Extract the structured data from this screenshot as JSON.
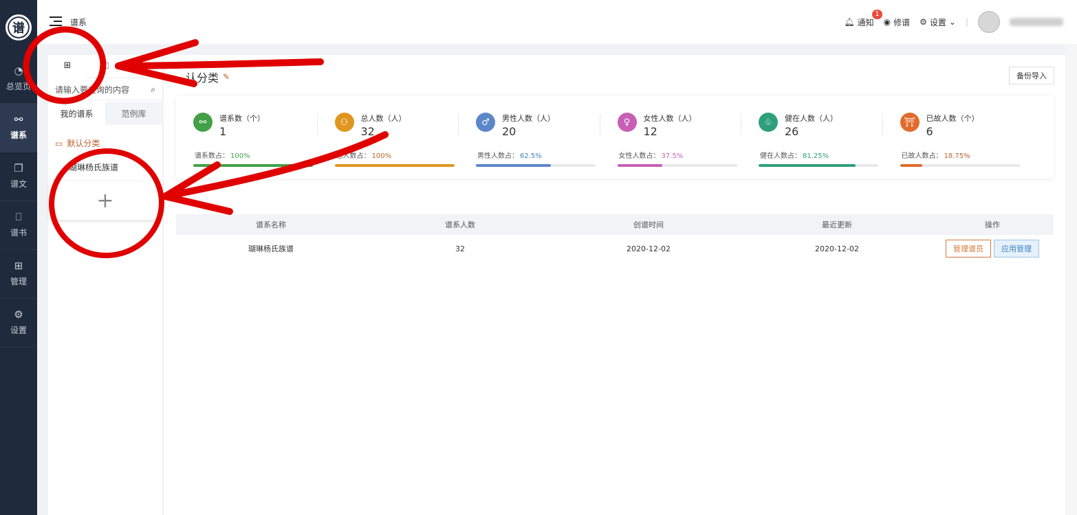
{
  "nav": {
    "logo_text": "谱",
    "items": [
      {
        "label": "总览页",
        "icon": "pie-chart-icon"
      },
      {
        "label": "谱系",
        "icon": "network-icon"
      },
      {
        "label": "谱文",
        "icon": "document-icon"
      },
      {
        "label": "谱书",
        "icon": "book-icon"
      },
      {
        "label": "管理",
        "icon": "apps-icon"
      },
      {
        "label": "设置",
        "icon": "gear-icon"
      }
    ]
  },
  "header": {
    "breadcrumb": "谱系",
    "notify_label": "通知",
    "notify_count": "1",
    "edit_label": "修谱",
    "settings_label": "设置"
  },
  "panel": {
    "search_placeholder": "请输入要查询的内容",
    "tab_mine": "我的谱系",
    "tab_examples": "范例库",
    "category": "默认分类",
    "item": "瑚琳杨氏族谱",
    "add_symbol": "+"
  },
  "main": {
    "title": "认分类",
    "backup_label": "备份导入",
    "stats": [
      {
        "label": "谱系数（个）",
        "value": "1",
        "ratio_label": "谱系数占：",
        "ratio": "100%",
        "percent": 100,
        "color": "#43a047",
        "ratio_color": "#43a047",
        "icon": "network-icon",
        "glyph": "⚯"
      },
      {
        "label": "总人数（人）",
        "value": "32",
        "ratio_label": "总人数占：",
        "ratio": "100%",
        "percent": 100,
        "color": "#e0961f",
        "ratio_color": "#c0602a",
        "icon": "person-icon",
        "glyph": "⚇"
      },
      {
        "label": "男性人数（人）",
        "value": "20",
        "ratio_label": "男性人数占：",
        "ratio": "62.5%",
        "percent": 62.5,
        "color": "#5b87c9",
        "ratio_color": "#3c82c8",
        "icon": "male-icon",
        "glyph": "♂"
      },
      {
        "label": "女性人数（人）",
        "value": "12",
        "ratio_label": "女性人数占：",
        "ratio": "37.5%",
        "percent": 37.5,
        "color": "#c85fb4",
        "ratio_color": "#c85fb4",
        "icon": "female-icon",
        "glyph": "♀"
      },
      {
        "label": "健在人数（人）",
        "value": "26",
        "ratio_label": "健在人数占：",
        "ratio": "81.25%",
        "percent": 81.25,
        "color": "#2e9f7a",
        "ratio_color": "#2e9f7a",
        "icon": "plant-icon",
        "glyph": "♧"
      },
      {
        "label": "已故人数（个）",
        "value": "6",
        "ratio_label": "已故人数占：",
        "ratio": "18.75%",
        "percent": 18.75,
        "color": "#e26a2c",
        "ratio_color": "#c0602a",
        "icon": "incense-icon",
        "glyph": "⛩"
      }
    ],
    "table": {
      "headers": [
        "谱系名称",
        "谱系人数",
        "创谱时间",
        "最近更新",
        "操作"
      ],
      "row": {
        "name": "瑚琳杨氏族谱",
        "count": "32",
        "created": "2020-12-02",
        "updated": "2020-12-02"
      },
      "btn_manage": "管理谱员",
      "btn_apps": "应用管理"
    }
  },
  "colors": {
    "annotation": "#e00000",
    "nav_bg": "#1f2a3c",
    "accent": "#c0602a"
  }
}
